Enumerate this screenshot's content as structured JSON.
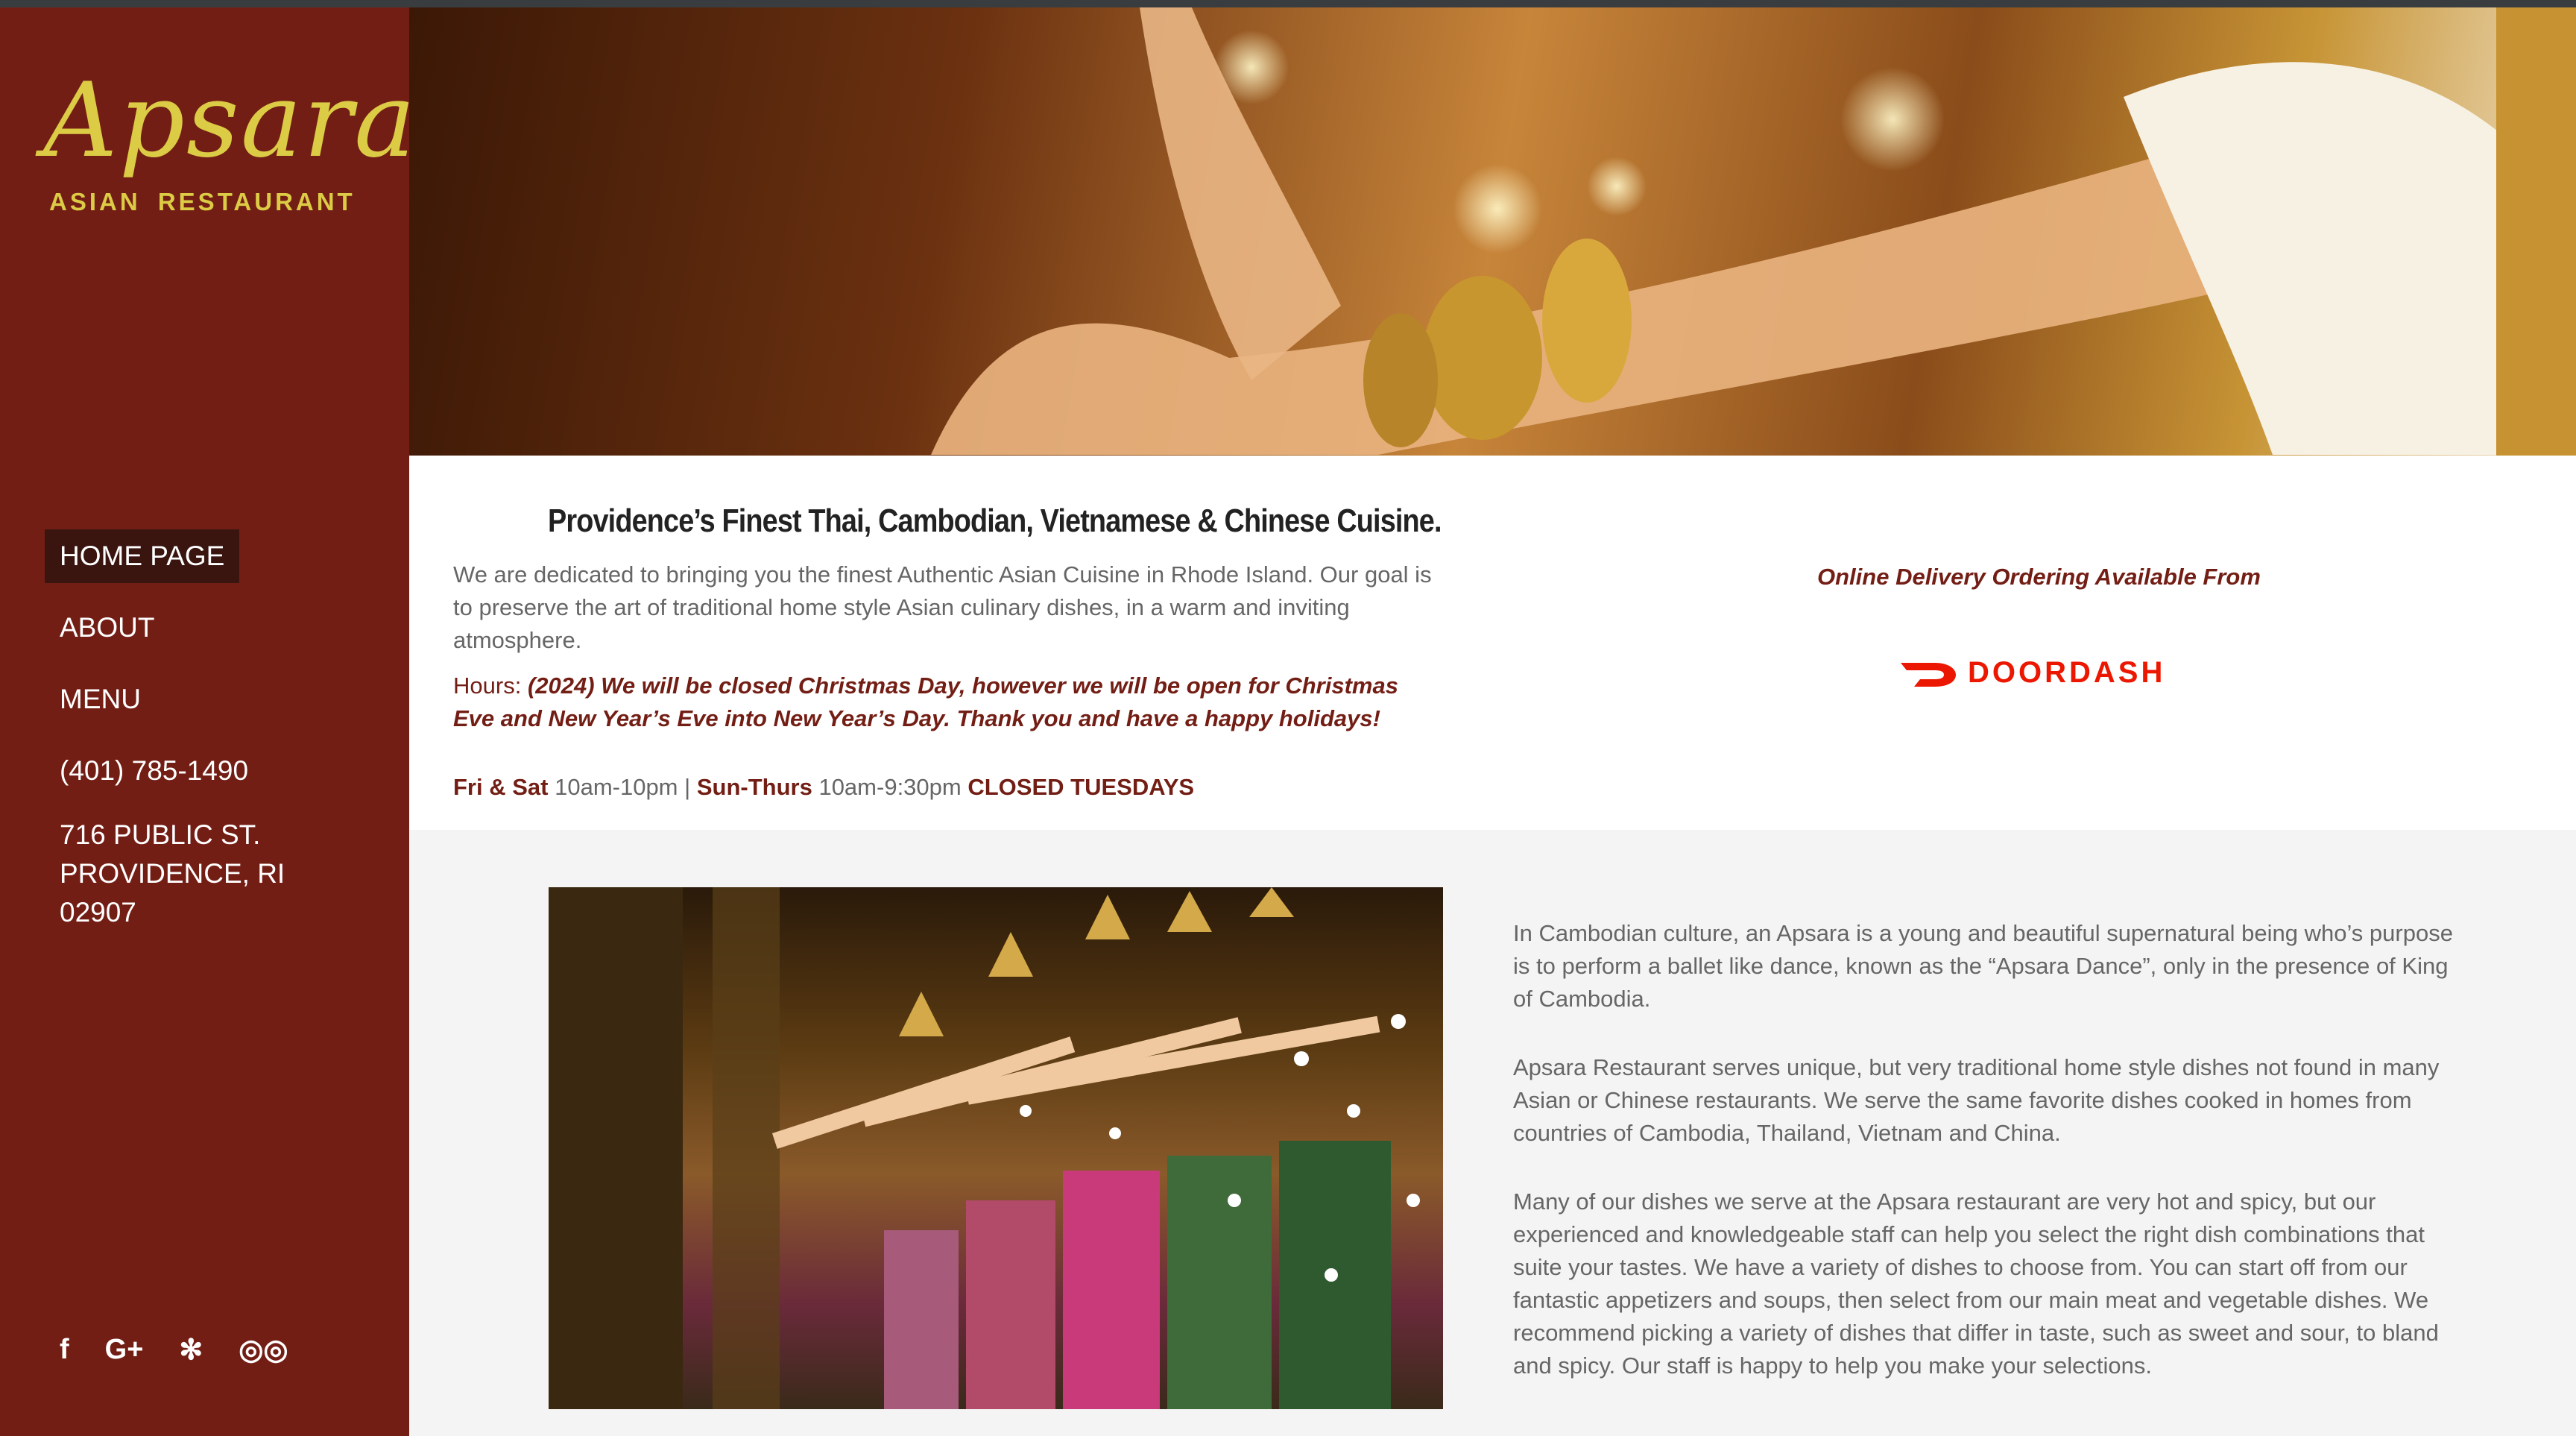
{
  "brand": {
    "logo_script": "Apsara",
    "logo_sub": "ASIAN RESTAURANT"
  },
  "nav": {
    "items": [
      {
        "label": "HOME PAGE",
        "active": true
      },
      {
        "label": "ABOUT"
      },
      {
        "label": "MENU"
      },
      {
        "label": "(401) 785-1490"
      }
    ],
    "address_lines": [
      "716 PUBLIC ST.",
      "PROVIDENCE, RI",
      "02907"
    ]
  },
  "social": [
    {
      "icon": "facebook-icon",
      "glyph": "f"
    },
    {
      "icon": "google-plus-icon",
      "glyph": "G+"
    },
    {
      "icon": "yelp-icon",
      "glyph": "✻"
    },
    {
      "icon": "tripadvisor-icon",
      "glyph": "◎◎"
    }
  ],
  "intro": {
    "headline": "Providence’s Finest Thai, Cambodian, Vietnamese & Chinese Cuisine.",
    "body": "We are dedicated to bringing you the finest Authentic Asian Cuisine in Rhode Island. Our goal is to preserve the art of traditional home style Asian culinary dishes, in a warm and inviting atmosphere.",
    "hours_label": "Hours:",
    "hours_notice": "(2024) We will be closed Christmas Day, however we will be open for Christmas Eve and New Year’s Eve into New Year’s Day. Thank you and have a happy holidays!",
    "fri_sat_label": "Fri & Sat",
    "fri_sat_time": "10am-10pm",
    "separator": "|",
    "sun_thu_label": "Sun-Thurs",
    "sun_thu_time": "10am-9:30pm",
    "closed": "CLOSED TUESDAYS"
  },
  "delivery": {
    "heading": "Online Delivery Ordering Available From",
    "partner": "DOORDASH"
  },
  "about": {
    "paragraphs": [
      "In Cambodian culture, an Apsara is a young and beautiful supernatural being who’s purpose is to perform a ballet like dance, known as the “Apsara Dance”, only in the presence of King of Cambodia.",
      "Apsara Restaurant serves unique, but very traditional home style dishes not found in many Asian or Chinese restaurants. We serve the same favorite dishes cooked in homes from countries of  Cambodia, Thailand, Vietnam and China.",
      "Many of our dishes we serve at the Apsara restaurant are very hot and spicy, but our experienced and knowledgeable staff can help you select the right dish combinations that suite your tastes.  We have a variety of dishes to choose from. You can start off from our fantastic appetizers and soups, then select  from our main meat and vegetable dishes. We recommend picking a variety of dishes that differ in taste, such as sweet and sour, to bland and spicy. Our staff is happy to help you make your selections."
    ]
  },
  "colors": {
    "sidebar": "#731e15",
    "accent": "#731e15",
    "logo": "#dccb45",
    "doordash": "#eb1700"
  }
}
